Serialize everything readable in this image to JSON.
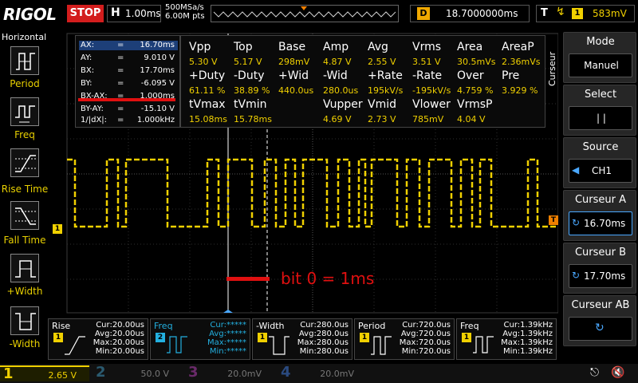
{
  "header": {
    "brand": "RIGOL",
    "run_state": "STOP",
    "horizontal_key": "H",
    "timebase": "1.00ms",
    "sample_rate": "500MSa/s",
    "memory_depth": "6.00M pts",
    "delay_key": "D",
    "delay": "18.7000000ms",
    "trigger_key": "T",
    "trigger_edge_icon": "rising-edge-icon",
    "trigger_channel": "1",
    "trigger_level": "583mV"
  },
  "left_menu": {
    "title": "Horizontal",
    "items": [
      {
        "label": "Period",
        "icon": "period-icon"
      },
      {
        "label": "Freq",
        "icon": "frequency-icon"
      },
      {
        "label": "Rise Time",
        "icon": "rise-time-icon"
      },
      {
        "label": "Fall Time",
        "icon": "fall-time-icon"
      },
      {
        "label": "+Width",
        "icon": "positive-width-icon"
      },
      {
        "label": "-Width",
        "icon": "negative-width-icon"
      }
    ]
  },
  "cursor_readout": {
    "rows": [
      {
        "name": "AX:",
        "eq": "=",
        "value": "16.70ms"
      },
      {
        "name": "AY:",
        "eq": "=",
        "value": "9.010 V"
      },
      {
        "name": "BX:",
        "eq": "=",
        "value": "17.70ms"
      },
      {
        "name": "BY:",
        "eq": "=",
        "value": "-6.095 V"
      },
      {
        "name": "BX-AX:",
        "eq": "=",
        "value": "1.000ms"
      },
      {
        "name": "BY-AY:",
        "eq": "=",
        "value": "-15.10 V"
      },
      {
        "name": "1/|dX|:",
        "eq": "=",
        "value": "1.000kHz"
      }
    ]
  },
  "measurements": {
    "rows": [
      {
        "headers": [
          "Vpp",
          "Top",
          "Base",
          "Amp",
          "Avg",
          "Vrms",
          "Area",
          "AreaP"
        ],
        "values": [
          "5.30 V",
          "5.17 V",
          "298mV",
          "4.87 V",
          "2.55 V",
          "3.51 V",
          "30.5mVs",
          "2.36mVs"
        ]
      },
      {
        "headers": [
          "+Duty",
          "-Duty",
          "+Wid",
          "-Wid",
          "+Rate",
          "-Rate",
          "Over",
          "Pre"
        ],
        "values": [
          "61.11 %",
          "38.89 %",
          "440.0us",
          "280.0us",
          "195kV/s",
          "-195kV/s",
          "4.759 %",
          "3.929 %"
        ]
      },
      {
        "headers": [
          "tVmax",
          "tVmin",
          "",
          "Vupper",
          "Vmid",
          "Vlower",
          "VrmsP",
          ""
        ],
        "values": [
          "15.08ms",
          "15.78ms",
          "",
          "4.69 V",
          "2.73 V",
          "785mV",
          "4.04 V",
          ""
        ]
      }
    ]
  },
  "annotation": {
    "text": "bit 0 = 1ms"
  },
  "markers": {
    "ch1": "1",
    "trigger": "T"
  },
  "right_menu": {
    "side_label": "Curseur",
    "buttons": [
      {
        "title": "Mode",
        "value": "Manuel",
        "selected": false,
        "icon": ""
      },
      {
        "title": "Select",
        "value": "|     |",
        "selected": false,
        "icon": ""
      },
      {
        "title": "Source",
        "value": "CH1",
        "selected": false,
        "icon": "left-arrow-icon"
      },
      {
        "title": "Curseur A",
        "value": "16.70ms",
        "selected": true,
        "icon": "rotate-knob-icon"
      },
      {
        "title": "Curseur B",
        "value": "17.70ms",
        "selected": false,
        "icon": "rotate-knob-icon"
      },
      {
        "title": "Curseur AB",
        "value": "",
        "selected": false,
        "icon": "rotate-knob-icon"
      }
    ]
  },
  "bottom_measurements": [
    {
      "title": "Rise",
      "channel": "1",
      "channel_color": "#f0d000",
      "icon": "rise-time-icon",
      "stats": [
        "Cur:20.00us",
        "Avg:20.00us",
        "Max:20.00us",
        "Min:20.00us"
      ]
    },
    {
      "title": "Freq",
      "channel": "2",
      "channel_color": "#23b0e0",
      "icon": "frequency-icon",
      "stats": [
        "Cur:*****",
        "Avg:*****",
        "Max:*****",
        "Min:*****"
      ]
    },
    {
      "title": "-Width",
      "channel": "1",
      "channel_color": "#f0d000",
      "icon": "negative-width-icon",
      "stats": [
        "Cur:280.0us",
        "Avg:280.0us",
        "Max:280.0us",
        "Min:280.0us"
      ]
    },
    {
      "title": "Period",
      "channel": "1",
      "channel_color": "#f0d000",
      "icon": "period-icon",
      "stats": [
        "Cur:720.0us",
        "Avg:720.0us",
        "Max:720.0us",
        "Min:720.0us"
      ]
    },
    {
      "title": "Freq",
      "channel": "1",
      "channel_color": "#f0d000",
      "icon": "frequency-icon",
      "stats": [
        "Cur:1.39kHz",
        "Avg:1.39kHz",
        "Max:1.39kHz",
        "Min:1.39kHz"
      ]
    }
  ],
  "channels": [
    {
      "num": "1",
      "scale": "2.65 V",
      "color": "#f0d000",
      "active": true
    },
    {
      "num": "2",
      "scale": "50.0 V",
      "color": "#23b0e0",
      "active": false
    },
    {
      "num": "3",
      "scale": "20.0mV",
      "color": "#d040d0",
      "active": false
    },
    {
      "num": "4",
      "scale": "20.0mV",
      "color": "#3090ff",
      "active": false
    }
  ],
  "status_icons": [
    "usb-icon",
    "speaker-mute-icon"
  ],
  "colors": {
    "ch1": "#f0d000",
    "ch2": "#23b0e0",
    "accent_blue": "#4aa8ff",
    "stop_red": "#d31d1d",
    "annotation_red": "#e01010",
    "trigger_orange": "#f08000"
  }
}
